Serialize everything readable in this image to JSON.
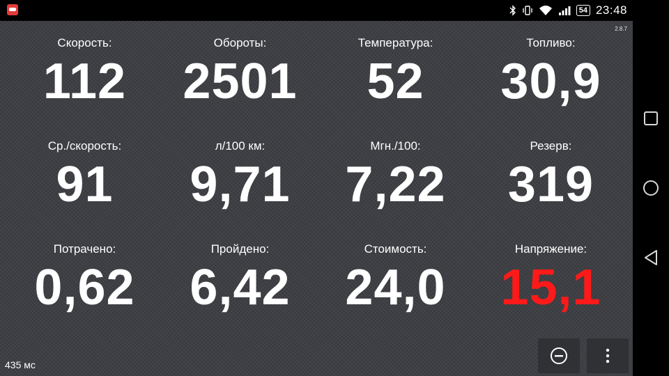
{
  "status_bar": {
    "time": "23:48",
    "battery": "54",
    "icons": [
      "app-icon",
      "bluetooth-icon",
      "vibrate-icon",
      "wifi-icon",
      "signal-icon",
      "battery-icon"
    ]
  },
  "app": {
    "version": "2.8.7",
    "ping": "435 мс",
    "colors": {
      "background": "#3b3d42",
      "text": "#ffffff",
      "alert": "#ff1a1a"
    }
  },
  "gauges": [
    {
      "label": "Скорость:",
      "value": "112"
    },
    {
      "label": "Обороты:",
      "value": "2501"
    },
    {
      "label": "Температура:",
      "value": "52"
    },
    {
      "label": "Топливо:",
      "value": "30,9"
    },
    {
      "label": "Ср./скорость:",
      "value": "91"
    },
    {
      "label": "л/100 км:",
      "value": "9,71"
    },
    {
      "label": "Мгн./100:",
      "value": "7,22"
    },
    {
      "label": "Резерв:",
      "value": "319"
    },
    {
      "label": "Потрачено:",
      "value": "0,62"
    },
    {
      "label": "Пройдено:",
      "value": "6,42"
    },
    {
      "label": "Стоимость:",
      "value": "24,0"
    },
    {
      "label": "Напряжение:",
      "value": "15,1"
    }
  ],
  "toolbar": {
    "buttons": [
      "minus-circle-icon",
      "more-vert-icon"
    ]
  },
  "nav_bar": {
    "buttons": [
      "recents-icon",
      "home-icon",
      "back-icon"
    ]
  }
}
